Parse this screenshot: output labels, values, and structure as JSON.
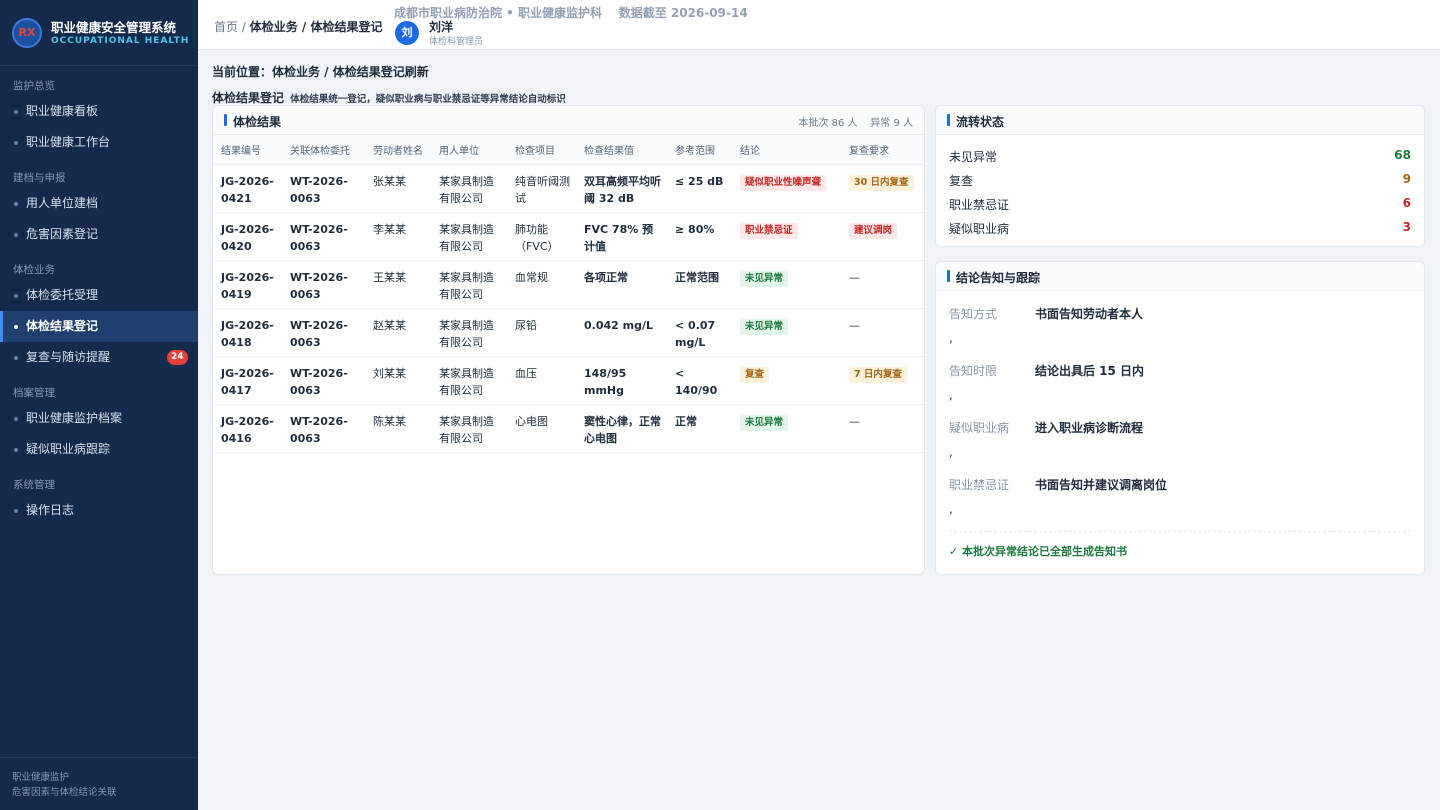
{
  "app": {
    "title": "职业健康安全管理系统",
    "subtitle": "OCCUPATIONAL HEALTH",
    "logo_text": "RX"
  },
  "sidebar": {
    "groups": [
      {
        "label": "监护总览",
        "items": [
          {
            "label": "职业健康看板"
          },
          {
            "label": "职业健康工作台"
          }
        ]
      },
      {
        "label": "建档与申报",
        "items": [
          {
            "label": "用人单位建档"
          },
          {
            "label": "危害因素登记"
          }
        ]
      },
      {
        "label": "体检业务",
        "items": [
          {
            "label": "体检委托受理"
          },
          {
            "label": "体检结果登记",
            "active": true
          },
          {
            "label": "复查与随访提醒",
            "badge": "24"
          }
        ]
      },
      {
        "label": "档案管理",
        "items": [
          {
            "label": "职业健康监护档案"
          },
          {
            "label": "疑似职业病跟踪"
          }
        ]
      },
      {
        "label": "系统管理",
        "items": [
          {
            "label": "操作日志"
          }
        ]
      }
    ],
    "footer": {
      "line1": "职业健康监护",
      "line2": "危害因素与体检结论关联"
    }
  },
  "topbar": {
    "crumb_home": "首页",
    "crumb_sep": "/",
    "crumb_path": "体检业务 / 体检结果登记",
    "org": "成都市职业病防治院 • 职业健康监护科    数据截至 2026-09-14",
    "avatar": "刘",
    "user_name": "刘洋",
    "user_role": "体检科管理员"
  },
  "page": {
    "location": "当前位置：体检业务 / 体检结果登记刷新",
    "section_title": "体检结果登记",
    "section_desc": "体检结果统一登记，疑似职业病与职业禁忌证等异常结论自动标识"
  },
  "results": {
    "title": "体检结果",
    "meta": "本批次 86 人    异常 9 人",
    "columns": [
      "结果编号",
      "关联体检委托",
      "劳动者姓名",
      "用人单位",
      "检查项目",
      "检查结果值",
      "参考范围",
      "结论",
      "复查要求"
    ],
    "rows": [
      {
        "id": "JG-2026-0421",
        "order": "WT-2026-0063",
        "name": "张某某",
        "unit": "某家具制造有限公司",
        "item": "纯音听阈测试",
        "value": "双耳高频平均听阈 32 dB",
        "range": "≤ 25 dB",
        "conclusion": "疑似职业性噪声聋",
        "c_tone": "red",
        "recheck": "30 日内复查",
        "r_tone": "orange"
      },
      {
        "id": "JG-2026-0420",
        "order": "WT-2026-0063",
        "name": "李某某",
        "unit": "某家具制造有限公司",
        "item": "肺功能（FVC）",
        "value": "FVC 78% 预计值",
        "range": "≥ 80%",
        "conclusion": "职业禁忌证",
        "c_tone": "red",
        "recheck": "建议调岗",
        "r_tone": "red"
      },
      {
        "id": "JG-2026-0419",
        "order": "WT-2026-0063",
        "name": "王某某",
        "unit": "某家具制造有限公司",
        "item": "血常规",
        "value": "各项正常",
        "range": "正常范围",
        "conclusion": "未见异常",
        "c_tone": "green",
        "recheck": "—",
        "r_tone": ""
      },
      {
        "id": "JG-2026-0418",
        "order": "WT-2026-0063",
        "name": "赵某某",
        "unit": "某家具制造有限公司",
        "item": "尿铅",
        "value": "0.042 mg/L",
        "range": "< 0.07 mg/L",
        "conclusion": "未见异常",
        "c_tone": "green",
        "recheck": "—",
        "r_tone": ""
      },
      {
        "id": "JG-2026-0417",
        "order": "WT-2026-0063",
        "name": "刘某某",
        "unit": "某家具制造有限公司",
        "item": "血压",
        "value": "148/95 mmHg",
        "range": "< 140/90",
        "conclusion": "复查",
        "c_tone": "orange",
        "recheck": "7 日内复查",
        "r_tone": "orange"
      },
      {
        "id": "JG-2026-0416",
        "order": "WT-2026-0063",
        "name": "陈某某",
        "unit": "某家具制造有限公司",
        "item": "心电图",
        "value": "窦性心律，正常心电图",
        "range": "正常",
        "conclusion": "未见异常",
        "c_tone": "green",
        "recheck": "—",
        "r_tone": ""
      }
    ]
  },
  "flow": {
    "title": "流转状态",
    "stats": [
      {
        "label": "未见异常",
        "value": "68",
        "color": "#1e7a3e"
      },
      {
        "label": "复查",
        "value": "9",
        "color": "#a86414"
      },
      {
        "label": "职业禁忌证",
        "value": "6",
        "color": "#c62828"
      },
      {
        "label": "疑似职业病",
        "value": "3",
        "color": "#c62828"
      }
    ]
  },
  "notify": {
    "title": "结论告知与跟踪",
    "rows": [
      {
        "key": "告知方式",
        "value": "书面告知劳动者本人",
        "comma": ","
      },
      {
        "key": "告知时限",
        "value": "结论出具后 15 日内",
        "comma": ","
      },
      {
        "key": "疑似职业病",
        "value": "进入职业病诊断流程",
        "comma": ","
      },
      {
        "key": "职业禁忌证",
        "value": "书面告知并建议调离岗位",
        "comma": ","
      }
    ],
    "done": "✓ 本批次异常结论已全部生成告知书"
  }
}
